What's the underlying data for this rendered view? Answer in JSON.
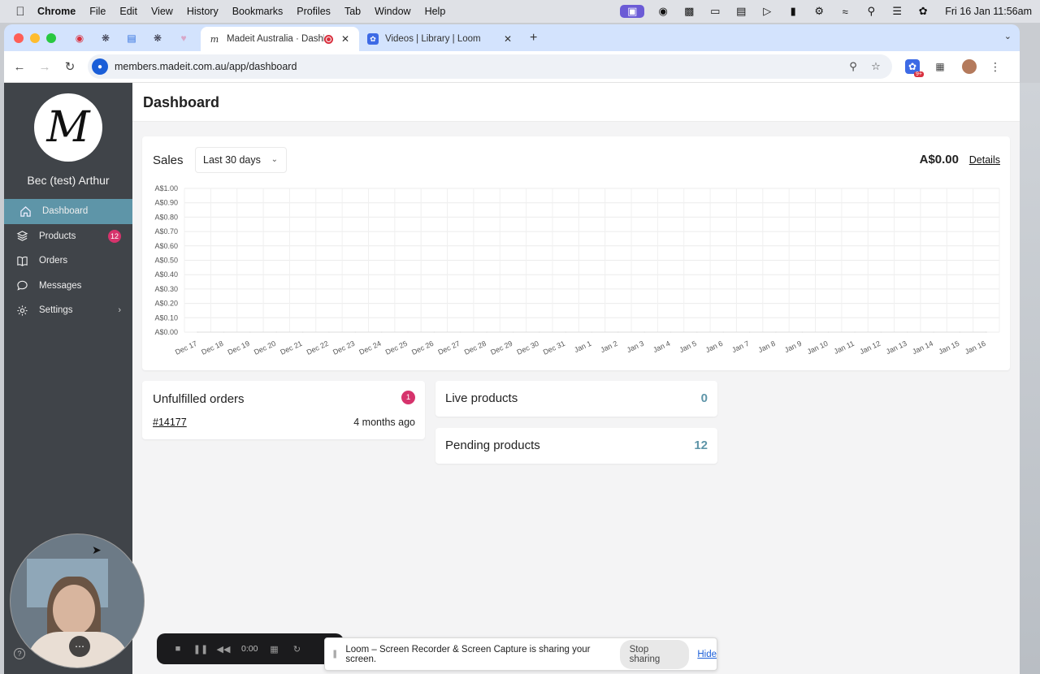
{
  "menubar": {
    "app": "Chrome",
    "items": [
      "File",
      "Edit",
      "View",
      "History",
      "Bookmarks",
      "Profiles",
      "Tab",
      "Window",
      "Help"
    ],
    "clock": "Fri 16 Jan  11:56am"
  },
  "browser": {
    "tabs": [
      {
        "title": "Madeit Australia · Dashbo",
        "active": true
      },
      {
        "title": "Videos | Library | Loom",
        "active": false
      }
    ],
    "url": "members.madeit.com.au/app/dashboard"
  },
  "sidebar": {
    "logo_letter": "M",
    "user_name": "Bec (test) Arthur",
    "items": [
      {
        "label": "Dashboard",
        "icon": "home-icon",
        "active": true
      },
      {
        "label": "Products",
        "icon": "layers-icon",
        "badge": "12"
      },
      {
        "label": "Orders",
        "icon": "book-icon"
      },
      {
        "label": "Messages",
        "icon": "chat-icon"
      },
      {
        "label": "Settings",
        "icon": "gear-icon"
      }
    ]
  },
  "page": {
    "title": "Dashboard"
  },
  "sales": {
    "title": "Sales",
    "range": "Last 30 days",
    "total": "A$0.00",
    "details": "Details"
  },
  "chart_data": {
    "type": "line",
    "title": "",
    "xlabel": "",
    "ylabel": "",
    "y_ticks": [
      "A$0.00",
      "A$0.10",
      "A$0.20",
      "A$0.30",
      "A$0.40",
      "A$0.50",
      "A$0.60",
      "A$0.70",
      "A$0.80",
      "A$0.90",
      "A$1.00"
    ],
    "ylim": [
      0,
      1
    ],
    "categories": [
      "Dec 17",
      "Dec 18",
      "Dec 19",
      "Dec 20",
      "Dec 21",
      "Dec 22",
      "Dec 23",
      "Dec 24",
      "Dec 25",
      "Dec 26",
      "Dec 27",
      "Dec 28",
      "Dec 29",
      "Dec 30",
      "Dec 31",
      "Jan 1",
      "Jan 2",
      "Jan 3",
      "Jan 4",
      "Jan 5",
      "Jan 6",
      "Jan 7",
      "Jan 8",
      "Jan 9",
      "Jan 10",
      "Jan 11",
      "Jan 12",
      "Jan 13",
      "Jan 14",
      "Jan 15",
      "Jan 16"
    ],
    "values": [
      0,
      0,
      0,
      0,
      0,
      0,
      0,
      0,
      0,
      0,
      0,
      0,
      0,
      0,
      0,
      0,
      0,
      0,
      0,
      0,
      0,
      0,
      0,
      0,
      0,
      0,
      0,
      0,
      0,
      0,
      0
    ],
    "grid": true
  },
  "unfulfilled": {
    "title": "Unfulfilled orders",
    "badge": "1",
    "order_number": "#14177",
    "order_age": "4 months ago"
  },
  "stats": {
    "live_label": "Live products",
    "live_value": "0",
    "pending_label": "Pending products",
    "pending_value": "12"
  },
  "loom": {
    "timer": "0:00",
    "share_message": "Loom – Screen Recorder & Screen Capture is sharing your screen.",
    "stop_label": "Stop sharing",
    "hide_label": "Hide"
  },
  "colors": {
    "accent": "#5e95a8",
    "badge": "#d6336c",
    "sidebar_bg": "#404449"
  }
}
